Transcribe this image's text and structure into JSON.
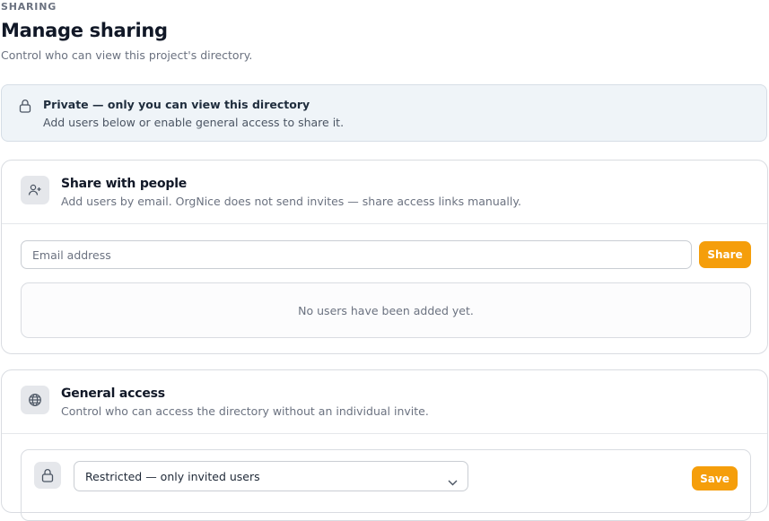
{
  "header": {
    "eyebrow": "SHARING",
    "title": "Manage sharing",
    "subtitle": "Control who can view this project's directory."
  },
  "banner": {
    "icon": "lock-icon",
    "title": "Private — only you can view this directory",
    "text": "Add users below or enable general access to share it."
  },
  "share_card": {
    "icon": "add-user-icon",
    "title": "Share with people",
    "description": "Add users by email. OrgNice does not send invites — share access links manually.",
    "email_placeholder": "Email address",
    "email_value": "",
    "share_button": "Share",
    "empty_text": "No users have been added yet."
  },
  "general_card": {
    "icon": "globe-icon",
    "title": "General access",
    "description": "Control who can access the directory without an individual invite.",
    "access_icon": "lock-icon",
    "access_selected": "Restricted — only invited users",
    "save_button": "Save"
  },
  "colors": {
    "accent": "#f59e0b",
    "banner_bg": "#eff4f8",
    "border": "#d9dce1",
    "muted_text": "#6b7280"
  }
}
